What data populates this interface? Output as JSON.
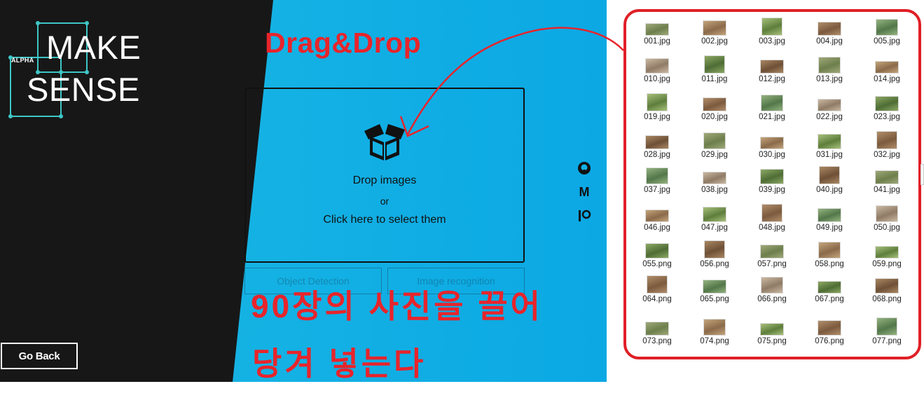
{
  "app": {
    "logo": {
      "alpha": "ALPHA",
      "line1": "MAKE",
      "line2": "SENSE"
    },
    "drop_zone": {
      "title": "Drop images",
      "or": "or",
      "select": "Click here to select them"
    },
    "modes": {
      "object_detection": "Object Detection",
      "image_recognition": "Image recognition"
    },
    "go_back": "Go Back",
    "side_icons": [
      "github-icon",
      "medium-icon",
      "patreon-icon"
    ]
  },
  "annotations": {
    "drag_drop": "Drag&Drop",
    "line1": "90장의 사진을 끌어",
    "line2": "당겨 넣는다",
    "color": "#e8242b"
  },
  "explorer": {
    "rows": [
      [
        "001.jpg",
        "002.jpg",
        "003.jpg",
        "004.jpg",
        "005.jpg"
      ],
      [
        "010.jpg",
        "011.jpg",
        "012.jpg",
        "013.jpg",
        "014.jpg"
      ],
      [
        "019.jpg",
        "020.jpg",
        "021.jpg",
        "022.jpg",
        "023.jpg"
      ],
      [
        "028.jpg",
        "029.jpg",
        "030.jpg",
        "031.jpg",
        "032.jpg"
      ],
      [
        "037.jpg",
        "038.jpg",
        "039.jpg",
        "040.jpg",
        "041.jpg"
      ],
      [
        "046.jpg",
        "047.jpg",
        "048.jpg",
        "049.jpg",
        "050.jpg"
      ],
      [
        "055.png",
        "056.png",
        "057.png",
        "058.png",
        "059.png"
      ],
      [
        "064.png",
        "065.png",
        "066.png",
        "067.png",
        "068.png"
      ],
      [
        "073.png",
        "074.png",
        "075.png",
        "076.png",
        "077.png"
      ]
    ]
  },
  "colors": {
    "dark": "#171717",
    "blue": "#0ba8e4",
    "red": "#e01f26",
    "logo_accent": "#3ec6c6"
  }
}
